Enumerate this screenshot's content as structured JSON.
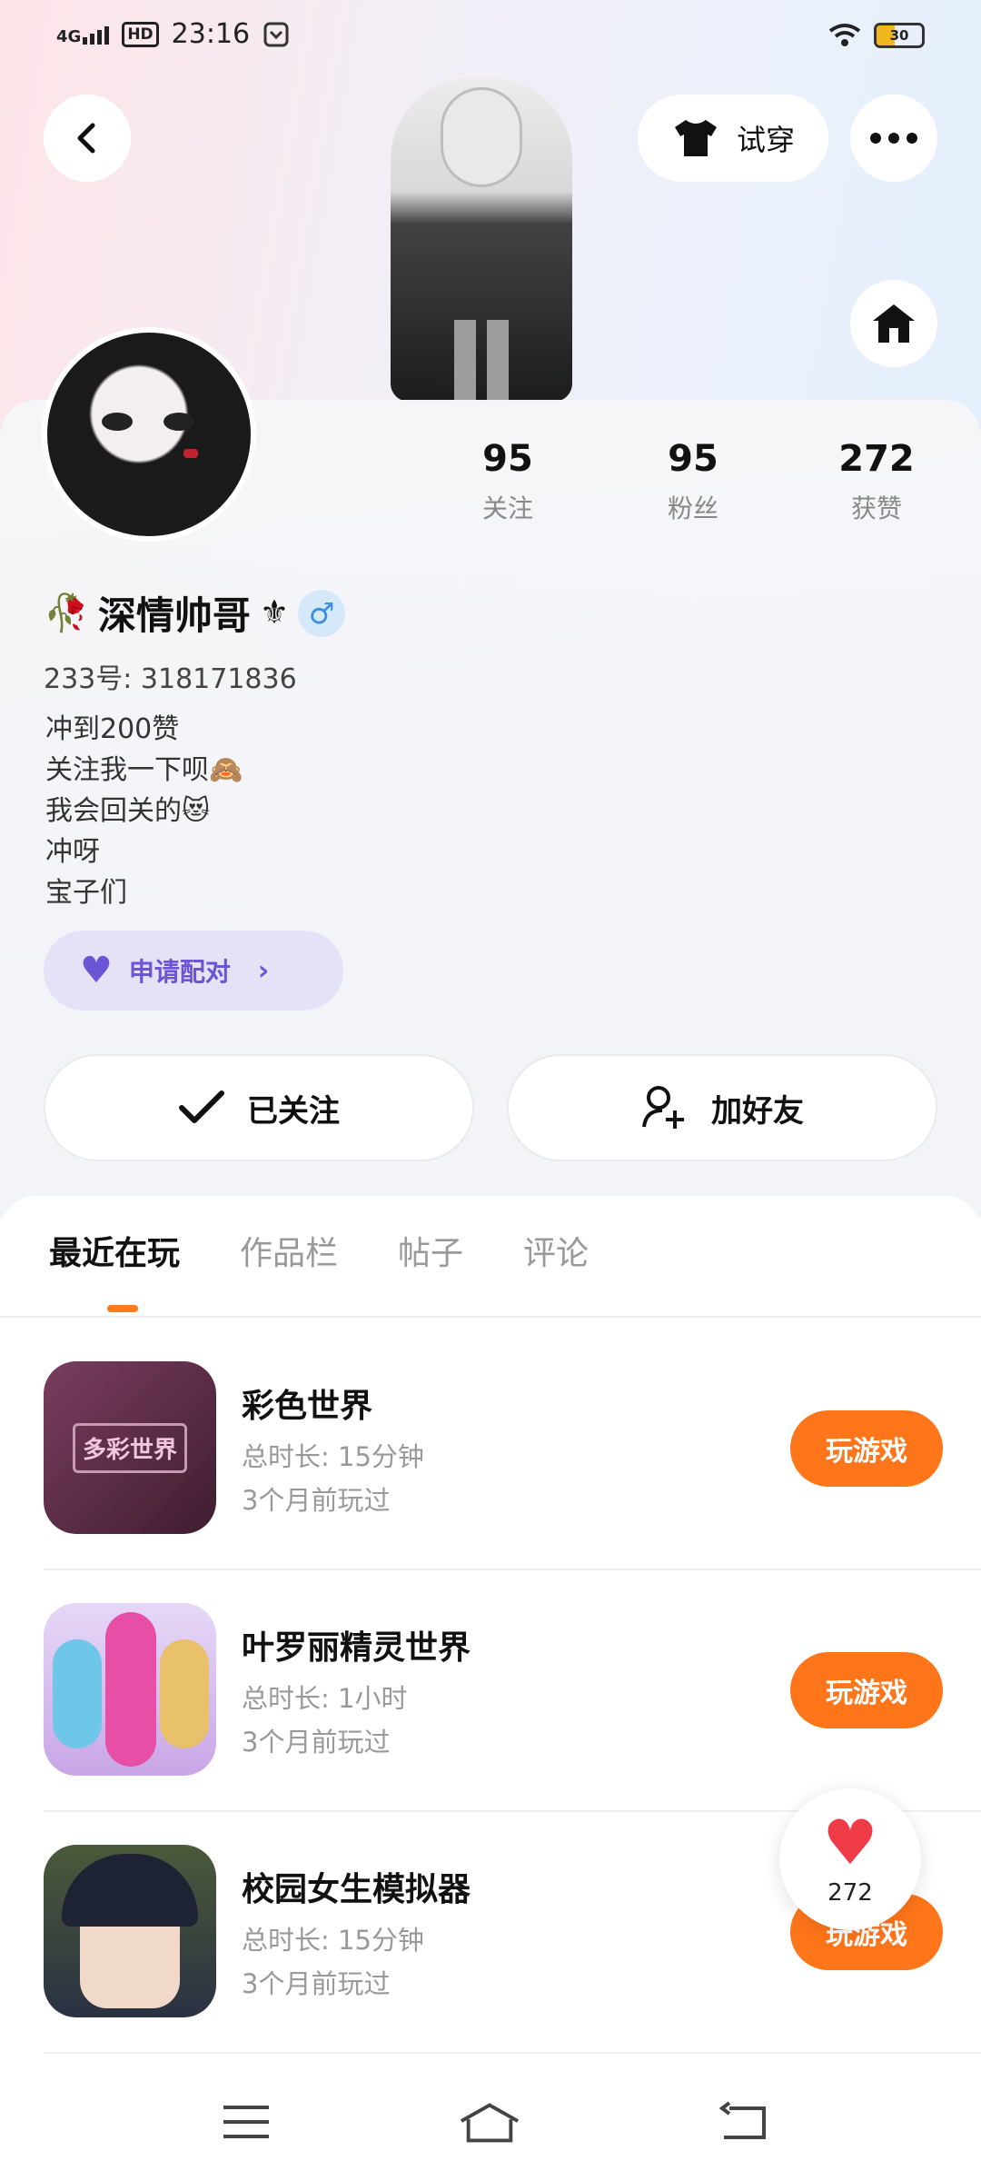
{
  "status_bar": {
    "network": "4G",
    "hd": "HD",
    "time": "23:16",
    "battery": "30",
    "battery_level": 0.3
  },
  "header": {
    "back_icon": "chevron-left-icon",
    "tryon_label": "试穿",
    "tryon_icon": "tshirt-icon",
    "more_icon": "more-icon",
    "home_icon": "home-icon"
  },
  "profile": {
    "name": "深情帅哥",
    "name_prefix_emoji": "🥀",
    "name_suffix_emoji": "⚜",
    "gender_symbol": "♂",
    "uid": "233号: 318171836",
    "bio": [
      "冲到200赞",
      "关注我一下呗🙈",
      "我会回关的😻",
      "冲呀",
      "宝子们"
    ],
    "pair_label": "申请配对",
    "stats": [
      {
        "num": "95",
        "label": "关注"
      },
      {
        "num": "95",
        "label": "粉丝"
      },
      {
        "num": "272",
        "label": "获赞"
      }
    ]
  },
  "actions": {
    "followed_label": "已关注",
    "add_friend_label": "加好友"
  },
  "tabs": [
    "最近在玩",
    "作品栏",
    "帖子",
    "评论"
  ],
  "games": [
    {
      "title": "彩色世界",
      "duration": "总时长: 15分钟",
      "last_played": "3个月前玩过",
      "button": "玩游戏",
      "icon_text": "多彩世界",
      "icon_color": "#5a2d45"
    },
    {
      "title": "叶罗丽精灵世界",
      "duration": "总时长: 1小时",
      "last_played": "3个月前玩过",
      "button": "玩游戏",
      "icon_color": "#d7c4ef"
    },
    {
      "title": "校园女生模拟器",
      "duration": "总时长: 15分钟",
      "last_played": "3个月前玩过",
      "button": "玩游戏",
      "icon_color": "#2a3142"
    }
  ],
  "like_float": {
    "count": "272"
  },
  "accent_color": "#ff7519"
}
